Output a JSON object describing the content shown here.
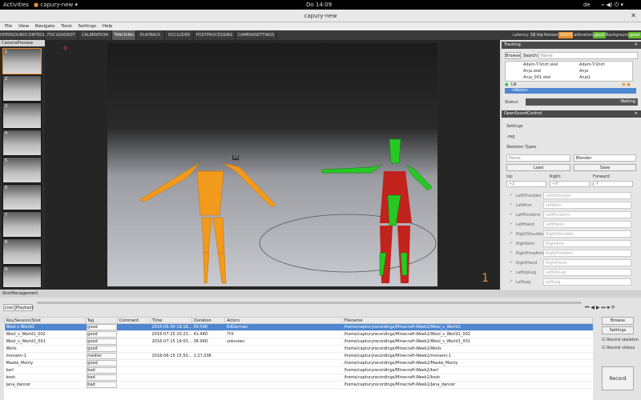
{
  "topbar": {
    "activities": "Activities",
    "app": "capury-new",
    "clock": "Do 14:09",
    "lang": "de"
  },
  "window": {
    "title": "capury-new"
  },
  "menu": [
    "File",
    "View",
    "Navigate",
    "Tools",
    "Settings",
    "Help"
  ],
  "tabs": [
    "OPENSOUNDCONTROL",
    "FOCUSASSIST",
    "CALIBRATION",
    "TRACKING",
    "PLAYBACK",
    "OCCLUDER",
    "POSTPROCESSING",
    "CAMERASETTINGS"
  ],
  "status": {
    "latency_label": "Latency:",
    "latency": "16 ms",
    "network_label": "Network:",
    "network": "DHCP",
    "calibration_label": "Calibration:",
    "calibration": "good",
    "background_label": "Background:",
    "background": "good"
  },
  "cameras": {
    "header": "CameraPreview",
    "items": [
      "1",
      "2",
      "3",
      "4",
      "5",
      "6",
      "7",
      "8",
      "9"
    ]
  },
  "viewport": {
    "camera_number": "1",
    "marker": "10"
  },
  "tracking": {
    "header": "Tracking",
    "browse": "Browse",
    "search_label": "Search:",
    "search_value": "Name",
    "actors": [
      {
        "name": "Adam-T-Shirt.skel",
        "alt": "Adam-T-Shirt"
      },
      {
        "name": "Anja.skel",
        "alt": "Anja"
      },
      {
        "name": "Anja_001.skel",
        "alt": "Anja1"
      }
    ],
    "slots": [
      "LN",
      "<None>"
    ],
    "status_label": "Status:",
    "status_value": "Waiting"
  },
  "osc": {
    "header": "OpenSoundControl",
    "settings": "Settings",
    "file": ".osg",
    "skeleton_types": "Skeleton Types",
    "name_placeholder": "Name",
    "type_value": "Blender",
    "load": "Load",
    "save": "Save",
    "up_label": "Up:",
    "right_label": "Right:",
    "forward_label": "Forward:",
    "up": "+Z",
    "right": "+X",
    "forward": "-Y",
    "bones": [
      {
        "name": "LeftShoulder",
        "value": "LeftShoulder"
      },
      {
        "name": "LeftArm",
        "value": "LeftArm"
      },
      {
        "name": "LeftForeArm",
        "value": "LeftForeArm"
      },
      {
        "name": "LeftHand",
        "value": "LeftHand"
      },
      {
        "name": "RightShoulder",
        "value": "RightShoulder"
      },
      {
        "name": "RightArm",
        "value": "RightArm"
      },
      {
        "name": "RightForeArm",
        "value": "RightForeArm"
      },
      {
        "name": "RightHand",
        "value": "RightHand"
      },
      {
        "name": "LeftUpLeg",
        "value": "LeftUpLeg"
      },
      {
        "name": "LeftLeg",
        "value": "LeftLeg"
      }
    ]
  },
  "shots": {
    "header": "ShotManagement",
    "live": "Live",
    "playback": "Playback",
    "columns": [
      "Key/Session/Shot",
      "Tag",
      "Comment",
      "Time",
      "Duration",
      "Actors",
      "Filename"
    ],
    "rows": [
      {
        "key": "Wool s World1",
        "tag": "good",
        "comment": "",
        "time": "2016-06-30 16:18...",
        "duration": "00.568",
        "actors": "EdGerman",
        "file": "/home/capturyrecordings/Minecraft-Week2/Wool_s_World1"
      },
      {
        "key": "Wool_s_World1_002",
        "tag": "good",
        "comment": "",
        "time": "2016-07-15 20:23...",
        "duration": "41.44D",
        "actors": "?YX",
        "file": "/home/capturyrecordings/Minecraft-Week2/Wool_s_World1_002"
      },
      {
        "key": "Wool_s_World1_001",
        "tag": "good",
        "comment": "",
        "time": "2016-07-15 14:03...",
        "duration": "38.94D",
        "actors": "unknown",
        "file": "/home/capturyrecordings/Minecraft-Week2/Wool_s_World1_001"
      },
      {
        "key": "Wolls",
        "tag": "good",
        "comment": "",
        "time": "",
        "duration": "",
        "actors": "",
        "file": "/home/capturyrecordings/Minecraft-Week2/Wolls"
      },
      {
        "key": "monami-1",
        "tag": "medior",
        "comment": "",
        "time": "2016-06-15 15:50...",
        "duration": "1:27.036",
        "actors": "",
        "file": "/home/capturyrecordings/Minecraft-Week2/monami-1"
      },
      {
        "key": "Maske_Monty",
        "tag": "good",
        "comment": "",
        "time": "",
        "duration": "",
        "actors": "",
        "file": "/home/capturyrecordings/Minecraft-Week2/Maske_Monty"
      },
      {
        "key": "karl",
        "tag": "bad",
        "comment": "",
        "time": "",
        "duration": "",
        "actors": "",
        "file": "/home/capturyrecordings/Minecraft-Week2/karl"
      },
      {
        "key": "kosh",
        "tag": "bad",
        "comment": "",
        "time": "",
        "duration": "",
        "actors": "",
        "file": "/home/capturyrecordings/Minecraft-Week2/kosh"
      },
      {
        "key": "Jana_dancer",
        "tag": "bad",
        "comment": "",
        "time": "",
        "duration": "",
        "actors": "",
        "file": "/home/capturyrecordings/Minecraft-Week2/Jana_dancer"
      }
    ],
    "browse": "Browse",
    "settings": "Settings",
    "record_skeleton": "Record skeleton",
    "record_videos": "Record videos",
    "record": "Record"
  },
  "colors": {
    "accent": "#f08c1e",
    "good": "#5fb82c",
    "dhcp": "#e8912e",
    "selection": "#4f86d0"
  }
}
